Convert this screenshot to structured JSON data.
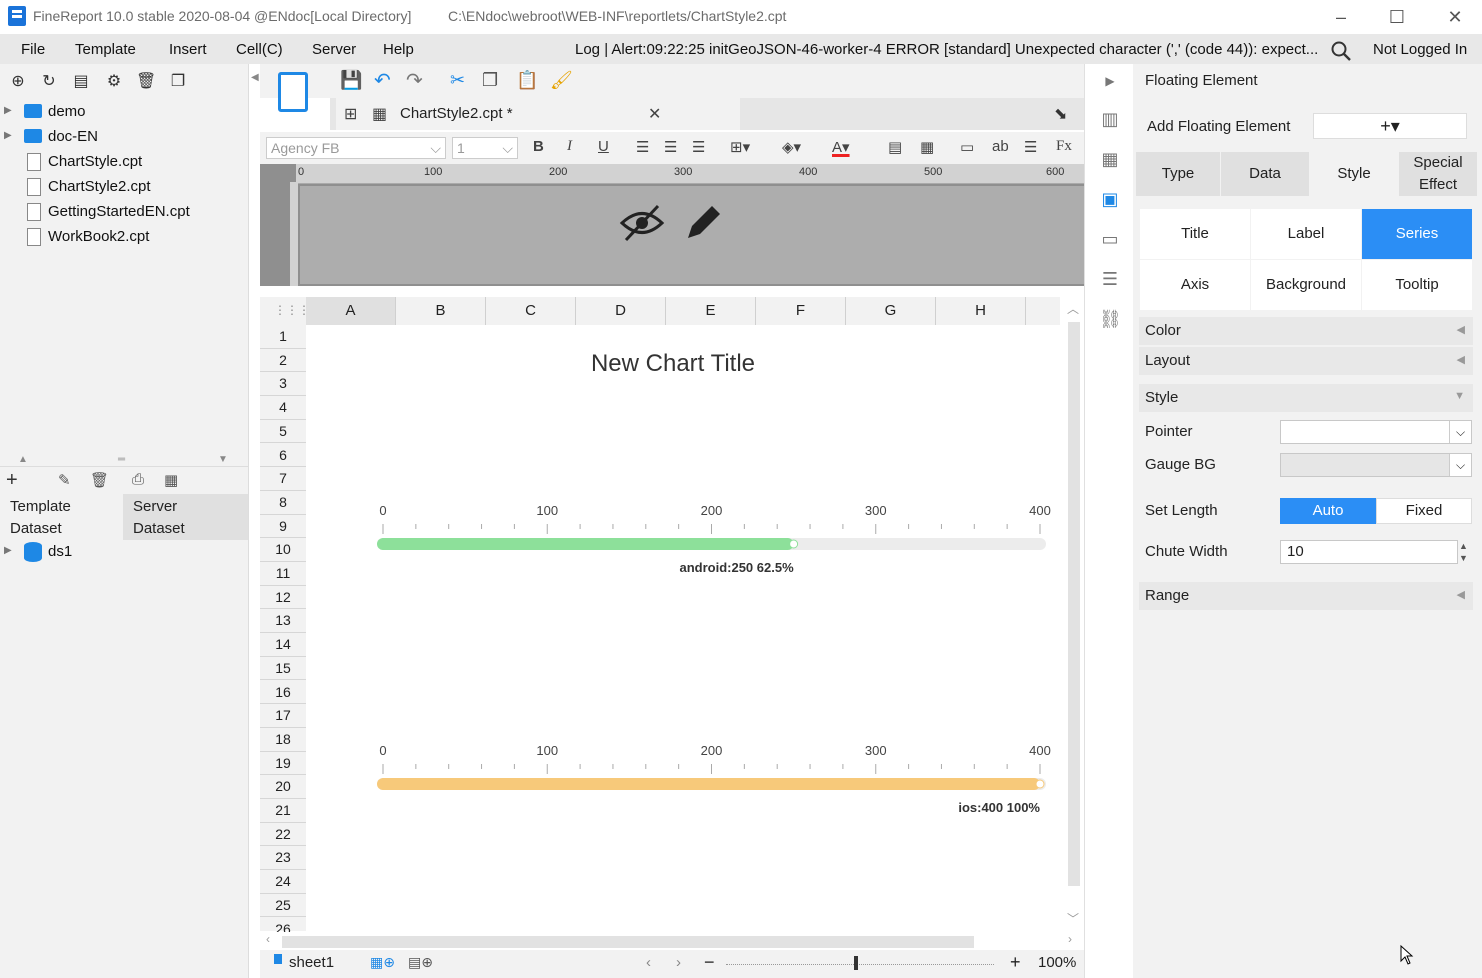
{
  "window": {
    "title": "FineReport 10.0 stable 2020-08-04 @ENdoc[Local Directory]",
    "path": "C:\\ENdoc\\webroot\\WEB-INF\\reportlets/ChartStyle2.cpt",
    "minimize": "–",
    "maximize": "☐",
    "close": "✕"
  },
  "menu": {
    "items": [
      "File",
      "Template",
      "Insert",
      "Cell(C)",
      "Server",
      "Help"
    ],
    "log": "Log | Alert:09:22:25 initGeoJSON-46-worker-4 ERROR [standard] Unexpected character (',' (code 44)): expect...",
    "login": "Not Logged In"
  },
  "tree": {
    "items": [
      {
        "label": "demo",
        "type": "folder"
      },
      {
        "label": "doc-EN",
        "type": "folder"
      },
      {
        "label": "ChartStyle.cpt",
        "type": "file"
      },
      {
        "label": "ChartStyle2.cpt",
        "type": "file"
      },
      {
        "label": "GettingStartedEN.cpt",
        "type": "file"
      },
      {
        "label": "WorkBook2.cpt",
        "type": "file"
      }
    ]
  },
  "dataset": {
    "tab_template_1": "Template",
    "tab_template_2": "Dataset",
    "tab_server_1": "Server",
    "tab_server_2": "Dataset",
    "ds": "ds1"
  },
  "editor": {
    "file_tab": "ChartStyle2.cpt *",
    "font": "Agency FB",
    "size": "1",
    "ruler_ticks": [
      "0",
      "100",
      "200",
      "300",
      "400",
      "500",
      "600"
    ],
    "columns": [
      "A",
      "B",
      "C",
      "D",
      "E",
      "F",
      "G",
      "H"
    ],
    "rows": [
      "1",
      "2",
      "3",
      "4",
      "5",
      "6",
      "7",
      "8",
      "9",
      "10",
      "11",
      "12",
      "13",
      "14",
      "15",
      "16",
      "17",
      "18",
      "19",
      "20",
      "21",
      "22",
      "23",
      "24",
      "25",
      "26"
    ],
    "sheet": "sheet1",
    "zoom": "100%"
  },
  "chart_data": {
    "type": "bar",
    "title": "New Chart Title",
    "axis_ticks": [
      "0",
      "100",
      "200",
      "300",
      "400"
    ],
    "xlim": [
      0,
      400
    ],
    "series": [
      {
        "category": "android",
        "value": 250,
        "percent": "62.5%",
        "label": "android:250  62.5%",
        "color": "#8de09a"
      },
      {
        "category": "ios",
        "value": 400,
        "percent": "100%",
        "label": "ios:400  100%",
        "color": "#f7c97a"
      }
    ]
  },
  "right_panel": {
    "header": "Floating Element",
    "add_label": "Add Floating Element",
    "add_btn": "+▾",
    "tabs": [
      "Type",
      "Data",
      "Style",
      "Special Effect"
    ],
    "active_tab": "Style",
    "sub_tabs": [
      "Title",
      "Label",
      "Series",
      "Axis",
      "Background",
      "Tooltip"
    ],
    "active_sub": "Series",
    "sections": {
      "color": "Color",
      "layout": "Layout",
      "style": "Style",
      "range": "Range"
    },
    "pointer_label": "Pointer",
    "gauge_bg_label": "Gauge BG",
    "set_length_label": "Set Length",
    "auto": "Auto",
    "fixed": "Fixed",
    "chute_width_label": "Chute Width",
    "chute_width": "10",
    "accent": "#2b8ef5"
  }
}
